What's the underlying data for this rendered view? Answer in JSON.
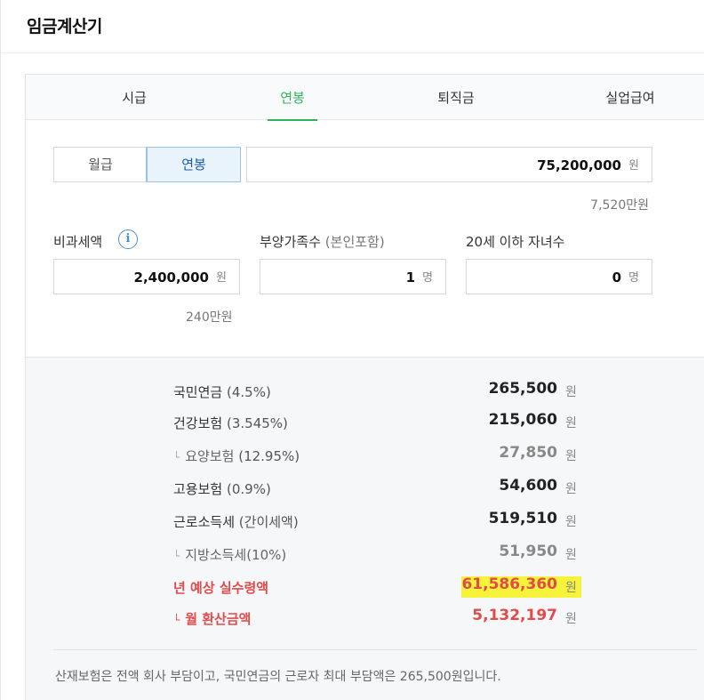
{
  "page": {
    "title": "임금계산기"
  },
  "tabs": [
    {
      "label": "시급",
      "active": false
    },
    {
      "label": "연봉",
      "active": true
    },
    {
      "label": "퇴직금",
      "active": false
    },
    {
      "label": "실업급여",
      "active": false
    }
  ],
  "salary_type": {
    "monthly_label": "월급",
    "yearly_label": "연봉",
    "selected": "연봉"
  },
  "salary_input": {
    "value": "75,200,000",
    "unit": "원",
    "note": "7,520만원"
  },
  "nontax": {
    "label": "비과세액",
    "value": "2,400,000",
    "unit": "원",
    "note": "240만원"
  },
  "dependents": {
    "label": "부양가족수",
    "label_sub": "(본인포함)",
    "value": "1",
    "unit": "명"
  },
  "children": {
    "label": "20세 이하 자녀수",
    "value": "0",
    "unit": "명"
  },
  "results": {
    "national_pension": {
      "label": "국민연금",
      "rate": "(4.5%)",
      "value": "265,500",
      "unit": "원"
    },
    "health_insurance": {
      "label": "건강보험",
      "rate": "(3.545%)",
      "value": "215,060",
      "unit": "원"
    },
    "longterm_care": {
      "label": "요양보험",
      "rate": "(12.95%)",
      "value": "27,850",
      "unit": "원"
    },
    "employment_insurance": {
      "label": "고용보험",
      "rate": "(0.9%)",
      "value": "54,600",
      "unit": "원"
    },
    "income_tax": {
      "label": "근로소득세",
      "rate": "(간이세액)",
      "value": "519,510",
      "unit": "원"
    },
    "local_tax": {
      "label": "지방소득세(10%)",
      "value": "51,950",
      "unit": "원"
    },
    "annual_net": {
      "label": "년 예상 실수령액",
      "value": "61,586,360",
      "unit": "원"
    },
    "monthly_net": {
      "label": "월 환산금액",
      "value": "5,132,197",
      "unit": "원"
    }
  },
  "footnote": "산재보험은 전액 회사 부담이고, 국민연금의 근로자 최대 부담액은 265,500원입니다.",
  "colors": {
    "accent_green": "#2fb45a",
    "red": "#e04b4b",
    "highlight": "#f7f23a",
    "info_blue": "#4a8cd6"
  },
  "icons": {
    "info": "info-icon",
    "corner": "sub-item-corner-icon"
  }
}
